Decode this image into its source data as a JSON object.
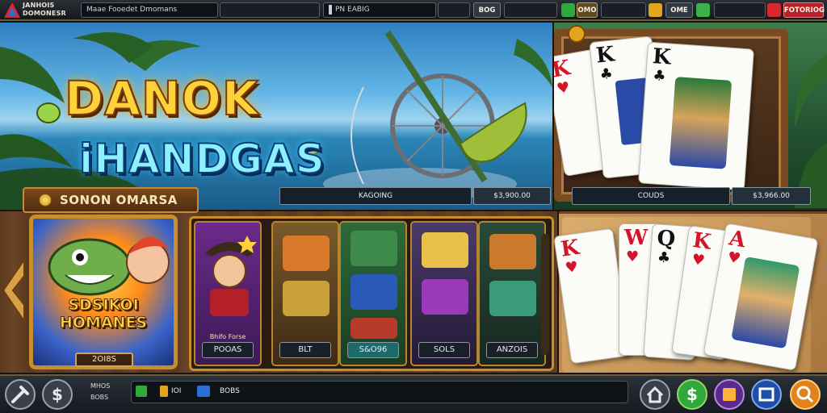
{
  "topbar": {
    "brand_line1": "JANHOIS",
    "brand_line2": "DOMONESR",
    "search_text": "Maae Fooedet Dmomans",
    "field2_text": "PN EABIG",
    "chip_text": "BOG",
    "currency1": "OMO",
    "currency2": "OME",
    "action_label": "FOTORIOG",
    "accent_color": "#d9272e"
  },
  "hero": {
    "title_line1": "DANOK",
    "title_line2": "iHANDGAS",
    "caption": "KAGOING",
    "value": "$3,900.00"
  },
  "cards_top": {
    "caption": "COUDS",
    "value": "$3,966.00",
    "cards": [
      {
        "rank": "K",
        "suit": "♥",
        "color": "red"
      },
      {
        "rank": "K",
        "suit": "♣",
        "color": "black"
      },
      {
        "rank": "K",
        "suit": "♣",
        "color": "black"
      }
    ]
  },
  "section": {
    "tag_label": "SONON OMARSA"
  },
  "feature": {
    "title_line1": "SDSIKOI",
    "title_line2": "HOMANES",
    "value": "2OI8S"
  },
  "reels": [
    {
      "sub": "Bhifo Forse",
      "label": "POOAS"
    },
    {
      "sub": "",
      "label": "BLT"
    },
    {
      "sub": "",
      "label": "S&O96"
    },
    {
      "sub": "",
      "label": "SOLS"
    },
    {
      "sub": "",
      "label": "ANZOIS"
    }
  ],
  "cards_table": {
    "cards": [
      {
        "rank": "K",
        "suit": "♥",
        "color": "red"
      },
      {
        "rank": "W",
        "suit": "♥",
        "color": "red"
      },
      {
        "rank": "Q",
        "suit": "♣",
        "color": "black"
      },
      {
        "rank": "K",
        "suit": "♥",
        "color": "red"
      },
      {
        "rank": "A",
        "suit": "♥",
        "color": "red"
      }
    ]
  },
  "bottombar": {
    "text_line1": "MHOS",
    "text_line2": "BOBS",
    "stat1": "IOI",
    "stat2": "BOBS"
  }
}
